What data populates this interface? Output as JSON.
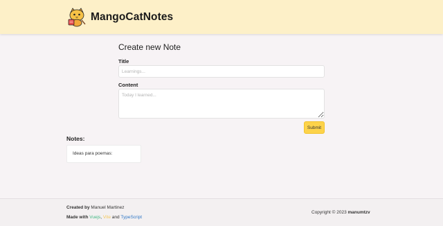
{
  "header": {
    "brand": "MangoCatNotes",
    "logo_icon": "mango-cat-logo-icon"
  },
  "form": {
    "title": "Create new Note",
    "title_label": "Title",
    "title_placeholder": "Learnings...",
    "content_label": "Content",
    "content_placeholder": "Today I learned...",
    "submit_label": "Submit"
  },
  "notes": {
    "heading": "Notes:",
    "items": [
      {
        "text": "Ideas para poemas:"
      }
    ]
  },
  "footer": {
    "created_by_label": "Created by",
    "author": "Manuel Martinez",
    "made_with_label": "Made with",
    "tech1": "Vuejs",
    "sep1": ",",
    "tech2": "Vite",
    "and": "and",
    "tech3": "TypeScript",
    "copyright": "Copyright © 2023",
    "handle": "manumtzv"
  },
  "colors": {
    "header_bg": "#fdf0c8",
    "page_bg": "#f7f3f5",
    "submit_bg": "#fdd34a",
    "vue": "#42b883",
    "vite": "#f4c85b",
    "typescript": "#3178c6"
  }
}
